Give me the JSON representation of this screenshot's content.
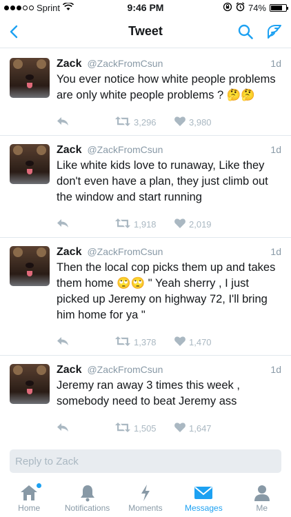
{
  "status_bar": {
    "carrier": "Sprint",
    "time": "9:46 PM",
    "battery": "74%",
    "battery_level": 0.74
  },
  "nav": {
    "title": "Tweet"
  },
  "tweets": [
    {
      "name": "Zack",
      "handle": "@ZackFromCsun",
      "time": "1d",
      "text": "You ever notice how white people problems are only white people problems ? 🤔🤔",
      "retweets": "3,296",
      "likes": "3,980"
    },
    {
      "name": "Zack",
      "handle": "@ZackFromCsun",
      "time": "1d",
      "text": "Like white kids love to runaway, Like they don't even have a plan, they just climb out the window and start running",
      "retweets": "1,918",
      "likes": "2,019"
    },
    {
      "name": "Zack",
      "handle": "@ZackFromCsun",
      "time": "1d",
      "text": "Then the local cop picks them up and takes them home 🙄🙄 \" Yeah sherry , I just picked up Jeremy on highway 72, I'll bring him home for ya \"",
      "retweets": "1,378",
      "likes": "1,470"
    },
    {
      "name": "Zack",
      "handle": "@ZackFromCsun",
      "time": "1d",
      "text": "Jeremy ran away 3 times this week , somebody need to beat Jeremy ass",
      "retweets": "1,505",
      "likes": "1,647"
    }
  ],
  "reply": {
    "placeholder": "Reply to Zack"
  },
  "tabs": [
    {
      "label": "Home",
      "icon": "home-icon"
    },
    {
      "label": "Notifications",
      "icon": "bell-icon"
    },
    {
      "label": "Moments",
      "icon": "lightning-icon"
    },
    {
      "label": "Messages",
      "icon": "envelope-icon",
      "active": true
    },
    {
      "label": "Me",
      "icon": "person-icon"
    }
  ],
  "colors": {
    "accent": "#1da1f2",
    "muted": "#8899a6",
    "reply_bg": "#e8ecf0"
  }
}
